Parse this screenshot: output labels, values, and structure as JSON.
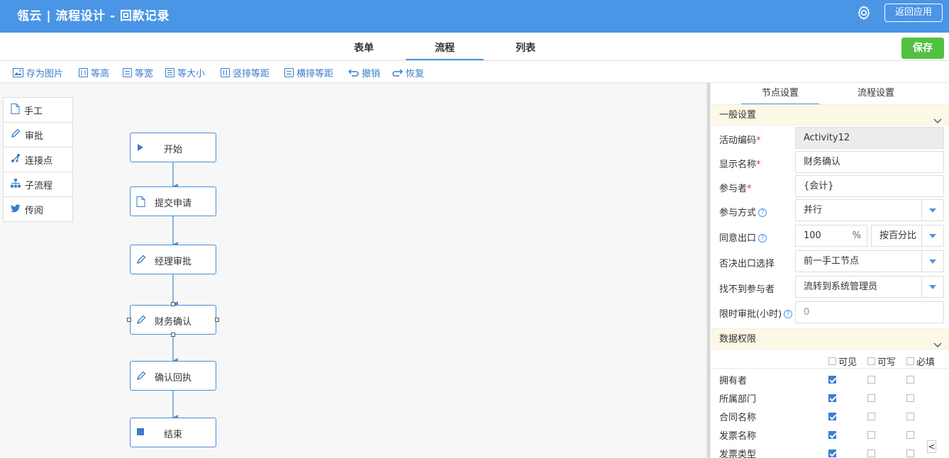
{
  "header": {
    "app_name": "瓴云 | 流程设计 - 回款记录",
    "back_button": "返回应用"
  },
  "tabs": [
    "表单",
    "流程",
    "列表"
  ],
  "active_tab": "流程",
  "save_button": "保存",
  "toolbar": [
    {
      "label": "存为图片",
      "icon": "image-icon"
    },
    {
      "label": "等高",
      "icon": "equal-height-icon"
    },
    {
      "label": "等宽",
      "icon": "equal-width-icon"
    },
    {
      "label": "等大小",
      "icon": "equal-size-icon"
    },
    {
      "label": "竖排等距",
      "icon": "vertical-distribute-icon"
    },
    {
      "label": "横排等距",
      "icon": "horizontal-distribute-icon"
    },
    {
      "label": "撤销",
      "icon": "undo-icon"
    },
    {
      "label": "恢复",
      "icon": "redo-icon"
    }
  ],
  "palette": [
    {
      "label": "手工",
      "icon": "document-icon"
    },
    {
      "label": "审批",
      "icon": "pencil-icon"
    },
    {
      "label": "连接点",
      "icon": "connector-icon"
    },
    {
      "label": "子流程",
      "icon": "sitemap-icon"
    },
    {
      "label": "传阅",
      "icon": "bird-icon"
    }
  ],
  "nodes": [
    {
      "label": "开始",
      "icon": "play-icon"
    },
    {
      "label": "提交申请",
      "icon": "document-icon"
    },
    {
      "label": "经理审批",
      "icon": "pencil-icon"
    },
    {
      "label": "财务确认",
      "icon": "pencil-icon",
      "selected": true
    },
    {
      "label": "确认回执",
      "icon": "pencil-icon"
    },
    {
      "label": "结束",
      "icon": "stop-icon"
    }
  ],
  "panel": {
    "tabs": [
      "节点设置",
      "流程设置"
    ],
    "active_tab": "节点设置",
    "general_section": "一般设置",
    "fields": {
      "activity_code": {
        "label": "活动编码",
        "value": "Activity12"
      },
      "display_name": {
        "label": "显示名称",
        "value": "财务确认"
      },
      "participants": {
        "label": "参与者",
        "value": "{会计}"
      },
      "participation_mode": {
        "label": "参与方式",
        "value": "并行"
      },
      "agree_exit": {
        "label": "同意出口",
        "value": "100",
        "unit": "%",
        "mode": "按百分比"
      },
      "reject_exit": {
        "label": "否决出口选择",
        "value": "前一手工节点"
      },
      "no_participant": {
        "label": "找不到参与者",
        "value": "流转到系统管理员"
      },
      "time_limit": {
        "label": "限时审批(小时)",
        "value": "0"
      }
    },
    "permissions_section": "数据权限",
    "permission_columns": [
      "可见",
      "可写",
      "必填"
    ],
    "permissions": [
      {
        "field": "拥有者",
        "visible": true,
        "writable": false,
        "required": false
      },
      {
        "field": "所属部门",
        "visible": true,
        "writable": false,
        "required": false
      },
      {
        "field": "合同名称",
        "visible": true,
        "writable": false,
        "required": false
      },
      {
        "field": "发票名称",
        "visible": true,
        "writable": false,
        "required": false
      },
      {
        "field": "发票类型",
        "visible": true,
        "writable": false,
        "required": false
      }
    ],
    "collapse_button": "<"
  },
  "colors": {
    "primary": "#4a95e6",
    "save": "#52c141",
    "section_bg": "#fdf8e6"
  }
}
